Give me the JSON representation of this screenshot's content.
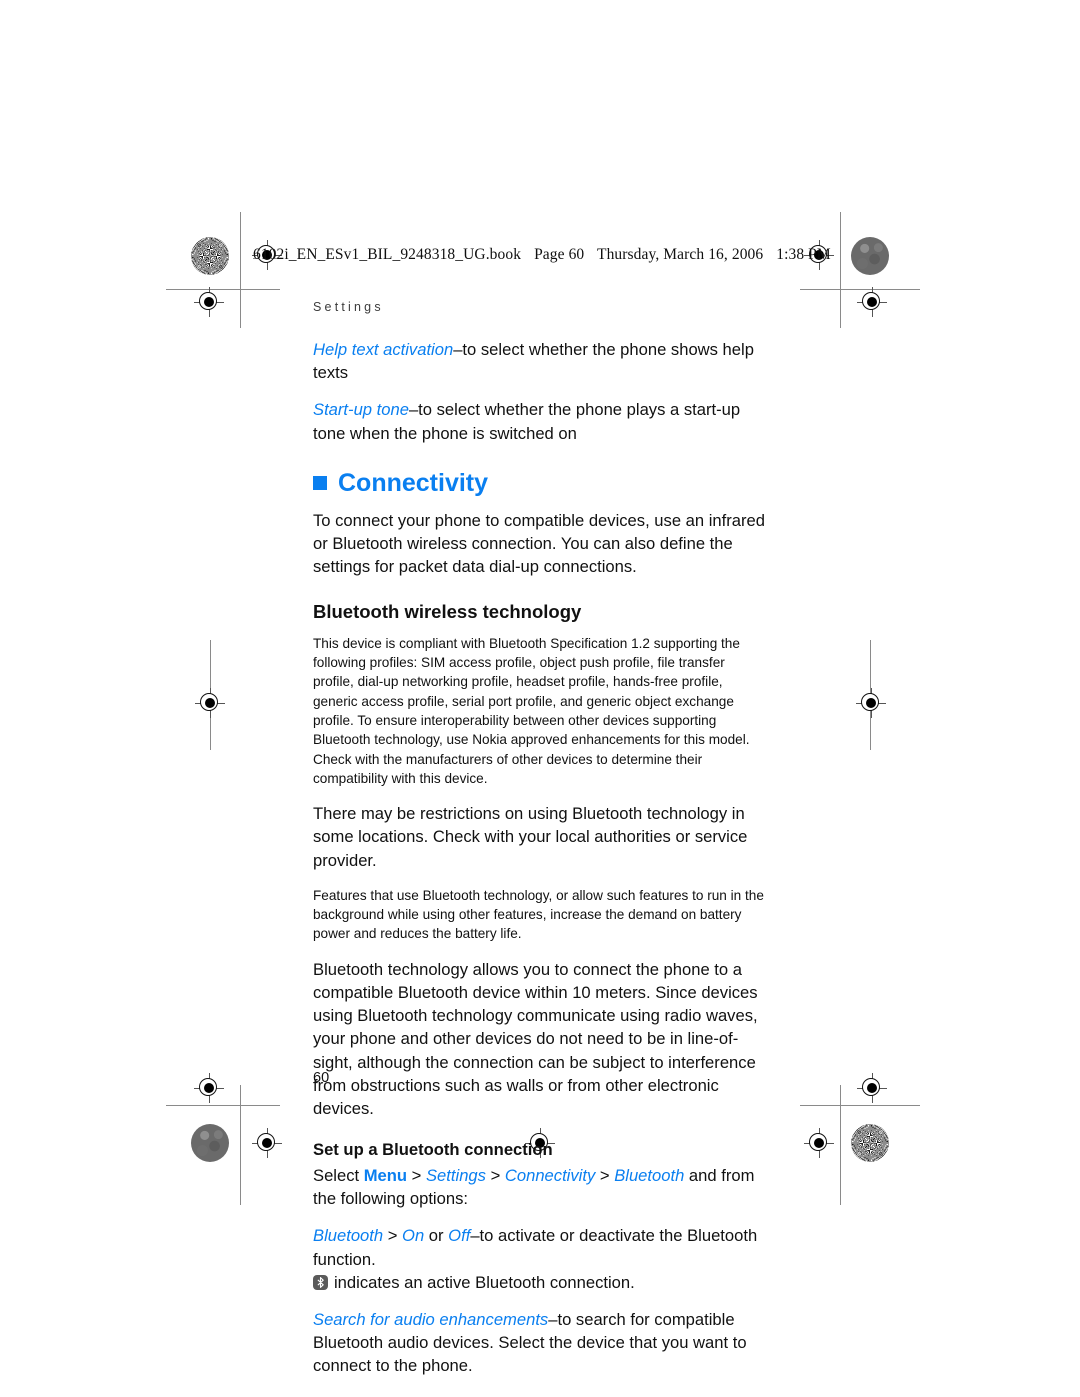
{
  "file_header": {
    "book": "6102i_EN_ESv1_BIL_9248318_UG.book",
    "page_label": "Page 60",
    "day": "Thursday, March 16, 2006",
    "time": "1:38 PM"
  },
  "running_head": "Settings",
  "page_number": "60",
  "colors": {
    "accent_blue": "#0a7ff0",
    "text": "#111111"
  },
  "settings_options": {
    "help_text_term": "Help text activation",
    "help_text_rest": "–to select whether the phone shows help texts",
    "startup_tone_term": "Start-up tone",
    "startup_tone_rest": "–to select whether the phone plays a start-up tone when the phone is switched on"
  },
  "connectivity": {
    "heading": "Connectivity",
    "intro": "To connect your phone to compatible devices, use an infrared or Bluetooth wireless connection. You can also define the settings for packet data dial-up connections."
  },
  "bluetooth": {
    "heading": "Bluetooth wireless technology",
    "spec_paragraph": "This device is compliant with Bluetooth Specification 1.2 supporting the following profiles: SIM access profile, object push profile, file transfer profile, dial-up networking profile, headset profile, hands-free profile, generic access profile, serial port profile, and generic object exchange profile. To ensure interoperability between other devices supporting Bluetooth technology, use Nokia approved enhancements for this model. Check with the manufacturers of other devices to determine their compatibility with this device.",
    "restrictions_paragraph": "There may be restrictions on using Bluetooth technology in some locations. Check with your local authorities or service provider.",
    "battery_paragraph": "Features that use Bluetooth technology, or allow such features to run in the background while using other features, increase the demand on battery power and reduces the battery life.",
    "range_paragraph": "Bluetooth technology allows you to connect the phone to a compatible Bluetooth device within 10 meters. Since devices using Bluetooth technology communicate using radio waves, your phone and other devices do not need to be in line-of-sight, although the connection can be subject to interference from obstructions such as walls or from other electronic devices."
  },
  "setup": {
    "heading": "Set up a Bluetooth connection",
    "select_prefix": "Select ",
    "menu": "Menu",
    "settings": "Settings",
    "connectivity": "Connectivity",
    "bluetooth": "Bluetooth",
    "select_suffix": " and from the following options:",
    "separator": " > ",
    "bluetooth_term": "Bluetooth",
    "on_term": "On",
    "or_text": " or ",
    "off_term": "Off",
    "toggle_rest": "–to activate or deactivate the Bluetooth function.",
    "icon_note": "indicates an active Bluetooth connection.",
    "icon_name": "bluetooth-icon",
    "search_term": "Search for audio enhancements",
    "search_rest": "–to search for compatible Bluetooth audio devices. Select the device that you want to connect to the phone."
  }
}
